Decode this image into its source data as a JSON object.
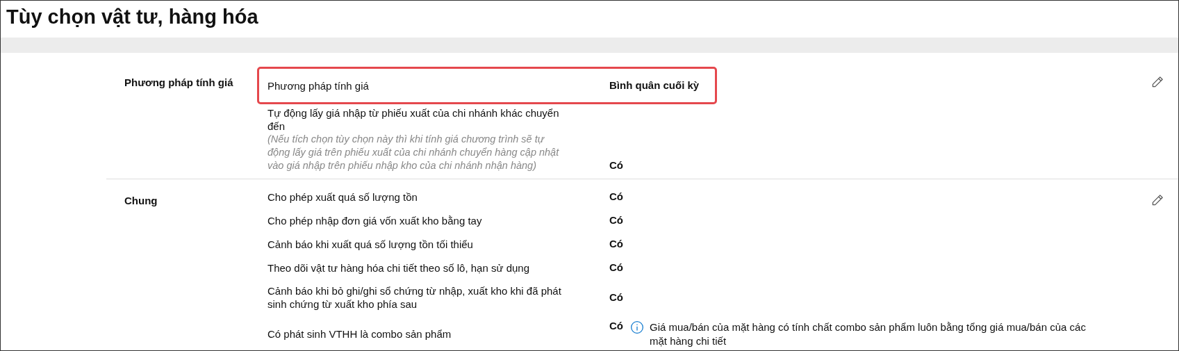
{
  "page_title": "Tùy chọn vật tư, hàng hóa",
  "sections": [
    {
      "title": "Phương pháp tính giá",
      "settings": [
        {
          "label": "Phương pháp tính giá",
          "value": "Bình quân cuối kỳ",
          "highlighted": true
        },
        {
          "label": "Tự động lấy giá nhập từ phiếu xuất của chi nhánh khác chuyển đến",
          "description": "(Nếu tích chọn tùy chọn này thì khi tính giá chương trình sẽ tự động lấy giá trên phiếu xuất của chi nhánh chuyển hàng cập nhật vào giá nhập trên phiếu nhập kho của chi nhánh nhận hàng)",
          "value": "Có",
          "highlighted": false
        }
      ]
    },
    {
      "title": "Chung",
      "settings": [
        {
          "label": "Cho phép xuất quá số lượng tồn",
          "value": "Có",
          "highlighted": false
        },
        {
          "label": "Cho phép nhập đơn giá vốn xuất kho bằng tay",
          "value": "Có",
          "highlighted": false
        },
        {
          "label": "Cảnh báo khi xuất quá số lượng tồn tối thiểu",
          "value": "Có",
          "highlighted": false
        },
        {
          "label": "Theo dõi vật tư hàng hóa chi tiết theo số lô, hạn sử dụng",
          "value": "Có",
          "highlighted": false
        },
        {
          "label": "Cảnh báo khi bỏ ghi/ghi sổ chứng từ nhập, xuất kho khi đã phát sinh chứng từ xuất kho phía sau",
          "value": "Có",
          "highlighted": false
        },
        {
          "label": "Có phát sinh VTHH là combo sản phẩm",
          "value": "Có",
          "note": "Giá mua/bán của mặt hàng có tính chất combo sản phẩm luôn bằng tổng giá mua/bán của các mặt hàng chi tiết",
          "highlighted": false
        }
      ]
    }
  ]
}
